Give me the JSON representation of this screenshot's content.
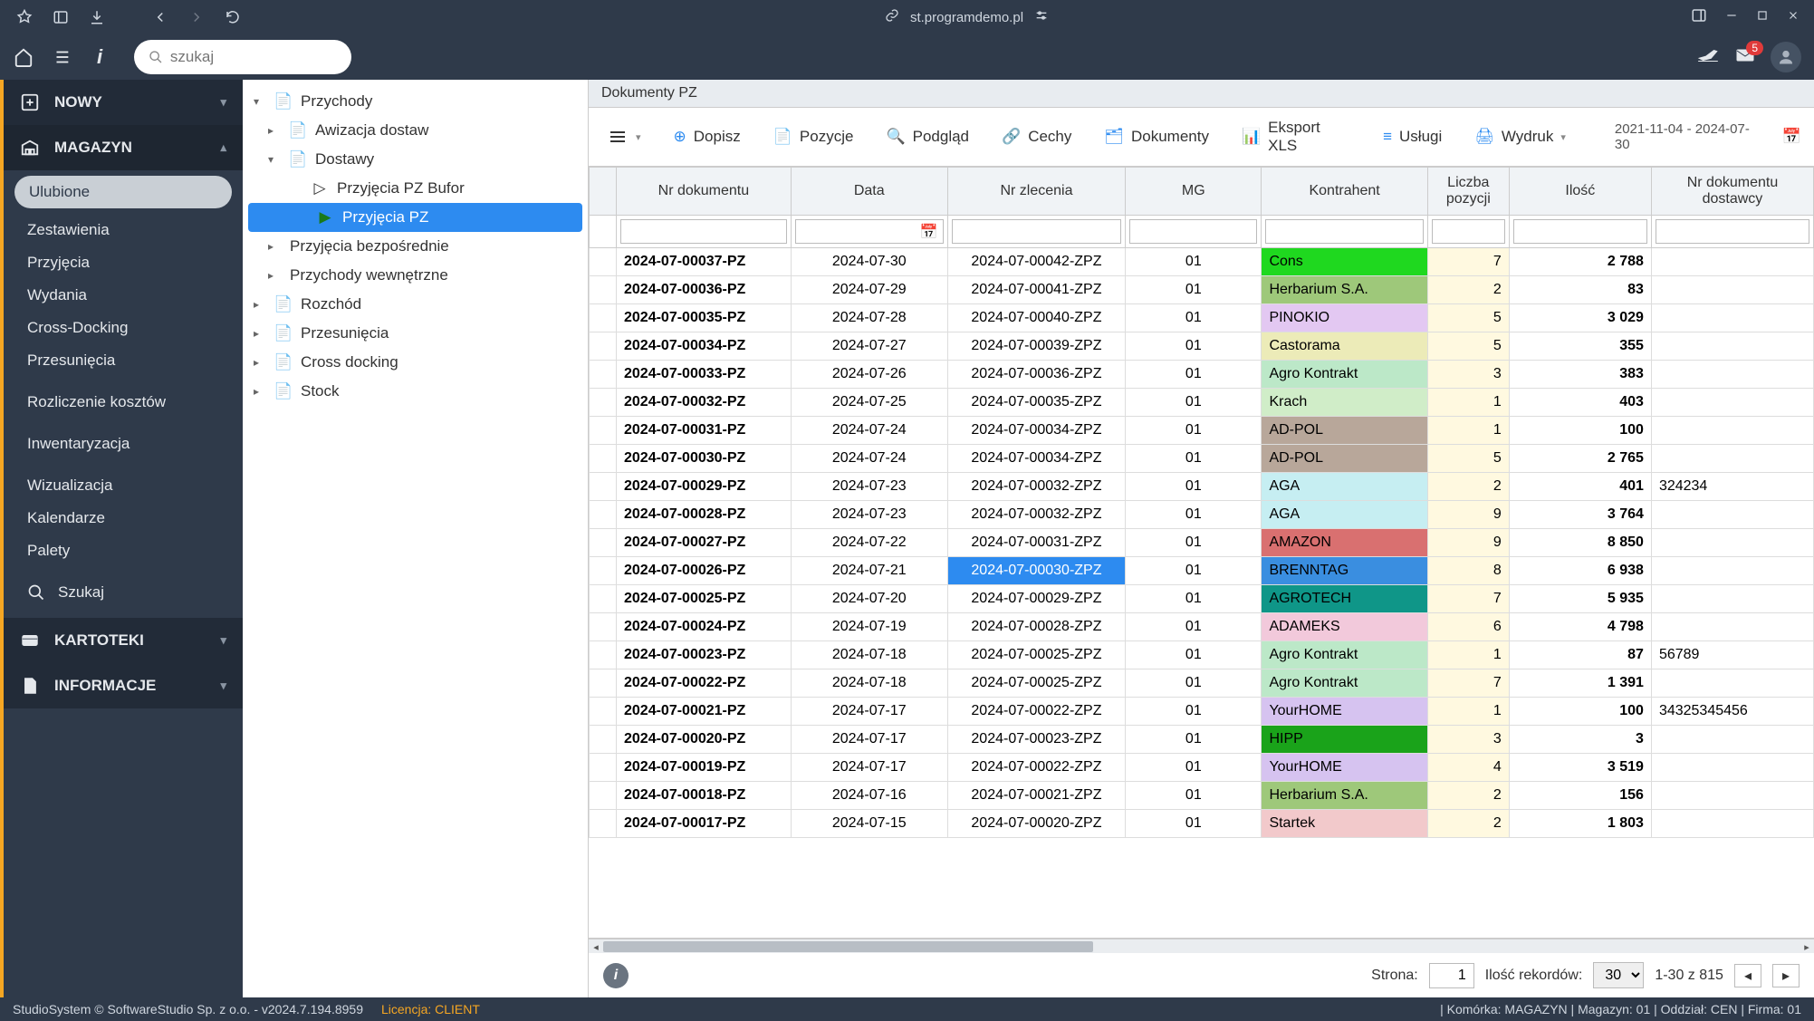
{
  "titlebar": {
    "url": "st.programdemo.pl"
  },
  "topbar": {
    "search_placeholder": "szukaj",
    "badge": "5"
  },
  "sidebar": {
    "nowy": "NOWY",
    "magazyn": "MAGAZYN",
    "items": [
      "Ulubione",
      "Zestawienia",
      "Przyjęcia",
      "Wydania",
      "Cross-Docking",
      "Przesunięcia"
    ],
    "rozliczenie": "Rozliczenie kosztów",
    "inwent": "Inwentaryzacja",
    "wiz": "Wizualizacja",
    "kal": "Kalendarze",
    "pal": "Palety",
    "szukaj": "Szukaj",
    "kartoteki": "KARTOTEKI",
    "informacje": "INFORMACJE"
  },
  "tree": {
    "przychody": "Przychody",
    "awizacja": "Awizacja dostaw",
    "dostawy": "Dostawy",
    "bufor": "Przyjęcia PZ Bufor",
    "pz": "Przyjęcia PZ",
    "bezposr": "Przyjęcia bezpośrednie",
    "wew": "Przychody wewnętrzne",
    "rozchod": "Rozchód",
    "przesun": "Przesunięcia",
    "cross": "Cross docking",
    "stock": "Stock"
  },
  "main": {
    "title": "Dokumenty PZ",
    "toolbar": {
      "dopisz": "Dopisz",
      "pozycje": "Pozycje",
      "podglad": "Podgląd",
      "cechy": "Cechy",
      "dokumenty": "Dokumenty",
      "eksport": "Eksport XLS",
      "uslugi": "Usługi",
      "wydruk": "Wydruk",
      "daterange": "2021-11-04 - 2024-07-30"
    },
    "headers": {
      "nrdok": "Nr dokumentu",
      "data": "Data",
      "nrzlec": "Nr zlecenia",
      "mg": "MG",
      "kontrahent": "Kontrahent",
      "liczba": "Liczba pozycji",
      "ilosc": "Ilość",
      "nrdost": "Nr dokumentu dostawcy"
    },
    "rows": [
      {
        "nr": "2024-07-00037-PZ",
        "data": "2024-07-30",
        "zl": "2024-07-00042-ZPZ",
        "mg": "01",
        "k": "Cons",
        "kc": "#1fd81f",
        "lp": "7",
        "il": "2 788",
        "nd": ""
      },
      {
        "nr": "2024-07-00036-PZ",
        "data": "2024-07-29",
        "zl": "2024-07-00041-ZPZ",
        "mg": "01",
        "k": "Herbarium S.A.",
        "kc": "#9ec87a",
        "lp": "2",
        "il": "83",
        "nd": ""
      },
      {
        "nr": "2024-07-00035-PZ",
        "data": "2024-07-28",
        "zl": "2024-07-00040-ZPZ",
        "mg": "01",
        "k": "PINOKIO",
        "kc": "#e3c8f2",
        "lp": "5",
        "il": "3 029",
        "nd": ""
      },
      {
        "nr": "2024-07-00034-PZ",
        "data": "2024-07-27",
        "zl": "2024-07-00039-ZPZ",
        "mg": "01",
        "k": "Castorama",
        "kc": "#ecebb8",
        "lp": "5",
        "il": "355",
        "nd": ""
      },
      {
        "nr": "2024-07-00033-PZ",
        "data": "2024-07-26",
        "zl": "2024-07-00036-ZPZ",
        "mg": "01",
        "k": "Agro Kontrakt",
        "kc": "#bce8c8",
        "lp": "3",
        "il": "383",
        "nd": ""
      },
      {
        "nr": "2024-07-00032-PZ",
        "data": "2024-07-25",
        "zl": "2024-07-00035-ZPZ",
        "mg": "01",
        "k": "Krach",
        "kc": "#d0edc8",
        "lp": "1",
        "il": "403",
        "nd": ""
      },
      {
        "nr": "2024-07-00031-PZ",
        "data": "2024-07-24",
        "zl": "2024-07-00034-ZPZ",
        "mg": "01",
        "k": "AD-POL",
        "kc": "#b8a79a",
        "lp": "1",
        "il": "100",
        "nd": ""
      },
      {
        "nr": "2024-07-00030-PZ",
        "data": "2024-07-24",
        "zl": "2024-07-00034-ZPZ",
        "mg": "01",
        "k": "AD-POL",
        "kc": "#b8a79a",
        "lp": "5",
        "il": "2 765",
        "nd": ""
      },
      {
        "nr": "2024-07-00029-PZ",
        "data": "2024-07-23",
        "zl": "2024-07-00032-ZPZ",
        "mg": "01",
        "k": "AGA",
        "kc": "#c6eef2",
        "lp": "2",
        "il": "401",
        "nd": "324234"
      },
      {
        "nr": "2024-07-00028-PZ",
        "data": "2024-07-23",
        "zl": "2024-07-00032-ZPZ",
        "mg": "01",
        "k": "AGA",
        "kc": "#c6eef2",
        "lp": "9",
        "il": "3 764",
        "nd": ""
      },
      {
        "nr": "2024-07-00027-PZ",
        "data": "2024-07-22",
        "zl": "2024-07-00031-ZPZ",
        "mg": "01",
        "k": "AMAZON",
        "kc": "#d97070",
        "lp": "9",
        "il": "8 850",
        "nd": ""
      },
      {
        "nr": "2024-07-00026-PZ",
        "data": "2024-07-21",
        "zl": "2024-07-00030-ZPZ",
        "mg": "01",
        "k": "BRENNTAG",
        "kc": "#3a8ee0",
        "lp": "8",
        "il": "6 938",
        "nd": "",
        "selzl": true
      },
      {
        "nr": "2024-07-00025-PZ",
        "data": "2024-07-20",
        "zl": "2024-07-00029-ZPZ",
        "mg": "01",
        "k": "AGROTECH",
        "kc": "#0f9688",
        "lp": "7",
        "il": "5 935",
        "nd": ""
      },
      {
        "nr": "2024-07-00024-PZ",
        "data": "2024-07-19",
        "zl": "2024-07-00028-ZPZ",
        "mg": "01",
        "k": "ADAMEKS",
        "kc": "#f2c9db",
        "lp": "6",
        "il": "4 798",
        "nd": ""
      },
      {
        "nr": "2024-07-00023-PZ",
        "data": "2024-07-18",
        "zl": "2024-07-00025-ZPZ",
        "mg": "01",
        "k": "Agro Kontrakt",
        "kc": "#bce8c8",
        "lp": "1",
        "il": "87",
        "nd": "56789"
      },
      {
        "nr": "2024-07-00022-PZ",
        "data": "2024-07-18",
        "zl": "2024-07-00025-ZPZ",
        "mg": "01",
        "k": "Agro Kontrakt",
        "kc": "#bce8c8",
        "lp": "7",
        "il": "1 391",
        "nd": ""
      },
      {
        "nr": "2024-07-00021-PZ",
        "data": "2024-07-17",
        "zl": "2024-07-00022-ZPZ",
        "mg": "01",
        "k": "YourHOME",
        "kc": "#d6c3f0",
        "lp": "1",
        "il": "100",
        "nd": "34325345456"
      },
      {
        "nr": "2024-07-00020-PZ",
        "data": "2024-07-17",
        "zl": "2024-07-00023-ZPZ",
        "mg": "01",
        "k": "HIPP",
        "kc": "#1aa31a",
        "lp": "3",
        "il": "3",
        "nd": ""
      },
      {
        "nr": "2024-07-00019-PZ",
        "data": "2024-07-17",
        "zl": "2024-07-00022-ZPZ",
        "mg": "01",
        "k": "YourHOME",
        "kc": "#d6c3f0",
        "lp": "4",
        "il": "3 519",
        "nd": ""
      },
      {
        "nr": "2024-07-00018-PZ",
        "data": "2024-07-16",
        "zl": "2024-07-00021-ZPZ",
        "mg": "01",
        "k": "Herbarium S.A.",
        "kc": "#9ec87a",
        "lp": "2",
        "il": "156",
        "nd": ""
      },
      {
        "nr": "2024-07-00017-PZ",
        "data": "2024-07-15",
        "zl": "2024-07-00020-ZPZ",
        "mg": "01",
        "k": "Startek",
        "kc": "#f2c9cb",
        "lp": "2",
        "il": "1 803",
        "nd": ""
      }
    ],
    "pager": {
      "strona": "Strona:",
      "strona_val": "1",
      "ilosc": "Ilość rekordów:",
      "ilosc_val": "30",
      "range": "1-30 z 815"
    }
  },
  "footer": {
    "left": "StudioSystem © SoftwareStudio Sp. z o.o. - v2024.7.194.8959",
    "lic": "Licencja: CLIENT",
    "right": "| Komórka: MAGAZYN | Magazyn: 01 | Oddział: CEN | Firma: 01"
  }
}
